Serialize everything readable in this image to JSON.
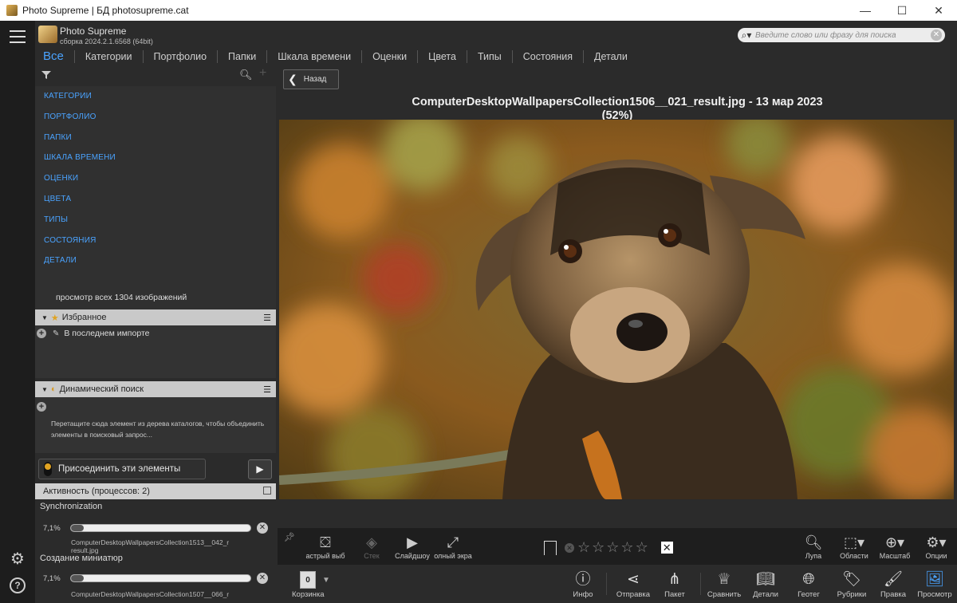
{
  "window": {
    "title": "Photo Supreme | БД photosupreme.cat",
    "minimize": "—",
    "maximize": "☐",
    "close": "✕"
  },
  "header": {
    "app_name": "Photo Supreme",
    "app_version": "сборка 2024.2.1.6568 (64bit)",
    "search_placeholder": "Введите слово или фразу для поиска"
  },
  "tabs": [
    "Все",
    "Категории",
    "Портфолио",
    "Папки",
    "Шкала времени",
    "Оценки",
    "Цвета",
    "Типы",
    "Состояния",
    "Детали"
  ],
  "catalog": {
    "items": [
      "КАТЕГОРИИ",
      "ПОРТФОЛИО",
      "ПАПКИ",
      "ШКАЛА ВРЕМЕНИ",
      "ОЦЕНКИ",
      "ЦВЕТА",
      "ТИПЫ",
      "СОСТОЯНИЯ",
      "ДЕТАЛИ"
    ],
    "view_all": "просмотр всех 1304 изображений"
  },
  "favorites": {
    "title": "Избранное",
    "item": "В последнем импорте"
  },
  "dynamic_search": {
    "title": "Динамический поиск",
    "hint": "Перетащите сюда элемент из дерева каталогов, чтобы объединить элементы в поисковый запрос...",
    "join_label": "Присоединить эти элементы"
  },
  "activity": {
    "title": "Активность (процессов: 2)",
    "tasks": [
      {
        "name": "Synchronization",
        "percent": "7,1%",
        "progress": 0.071,
        "file": "ComputerDesktopWallpapersCollection1513__042_r",
        "file2": "result.jpg"
      },
      {
        "name": "Создание миниатюр",
        "percent": "7,1%",
        "progress": 0.071,
        "file": "ComputerDesktopWallpapersCollection1507__066_r",
        "file2": ""
      }
    ]
  },
  "viewer": {
    "back_label": "Назад",
    "caption_line1": "ComputerDesktopWallpapersCollection1506__021_result.jpg  -  13 мар 2023",
    "caption_line2": "(52%)"
  },
  "viewer_toolbar": {
    "quick_select": "астрый выб",
    "stack": "Стек",
    "slideshow": "Слайдшоу",
    "fullscreen": "олный экра",
    "loupe": "Лупа",
    "areas": "Области",
    "zoom": "Масштаб",
    "options": "Опции",
    "rating": 0
  },
  "main_toolbar": {
    "basket_count": "0",
    "basket_label": "Корзинка",
    "info": "Инфо",
    "share": "Отправка",
    "batch": "Пакет",
    "compare": "Сравнить",
    "details": "Детали",
    "geotag": "Геотег",
    "rubrics": "Рубрики",
    "edit": "Правка",
    "view": "Просмотр"
  }
}
